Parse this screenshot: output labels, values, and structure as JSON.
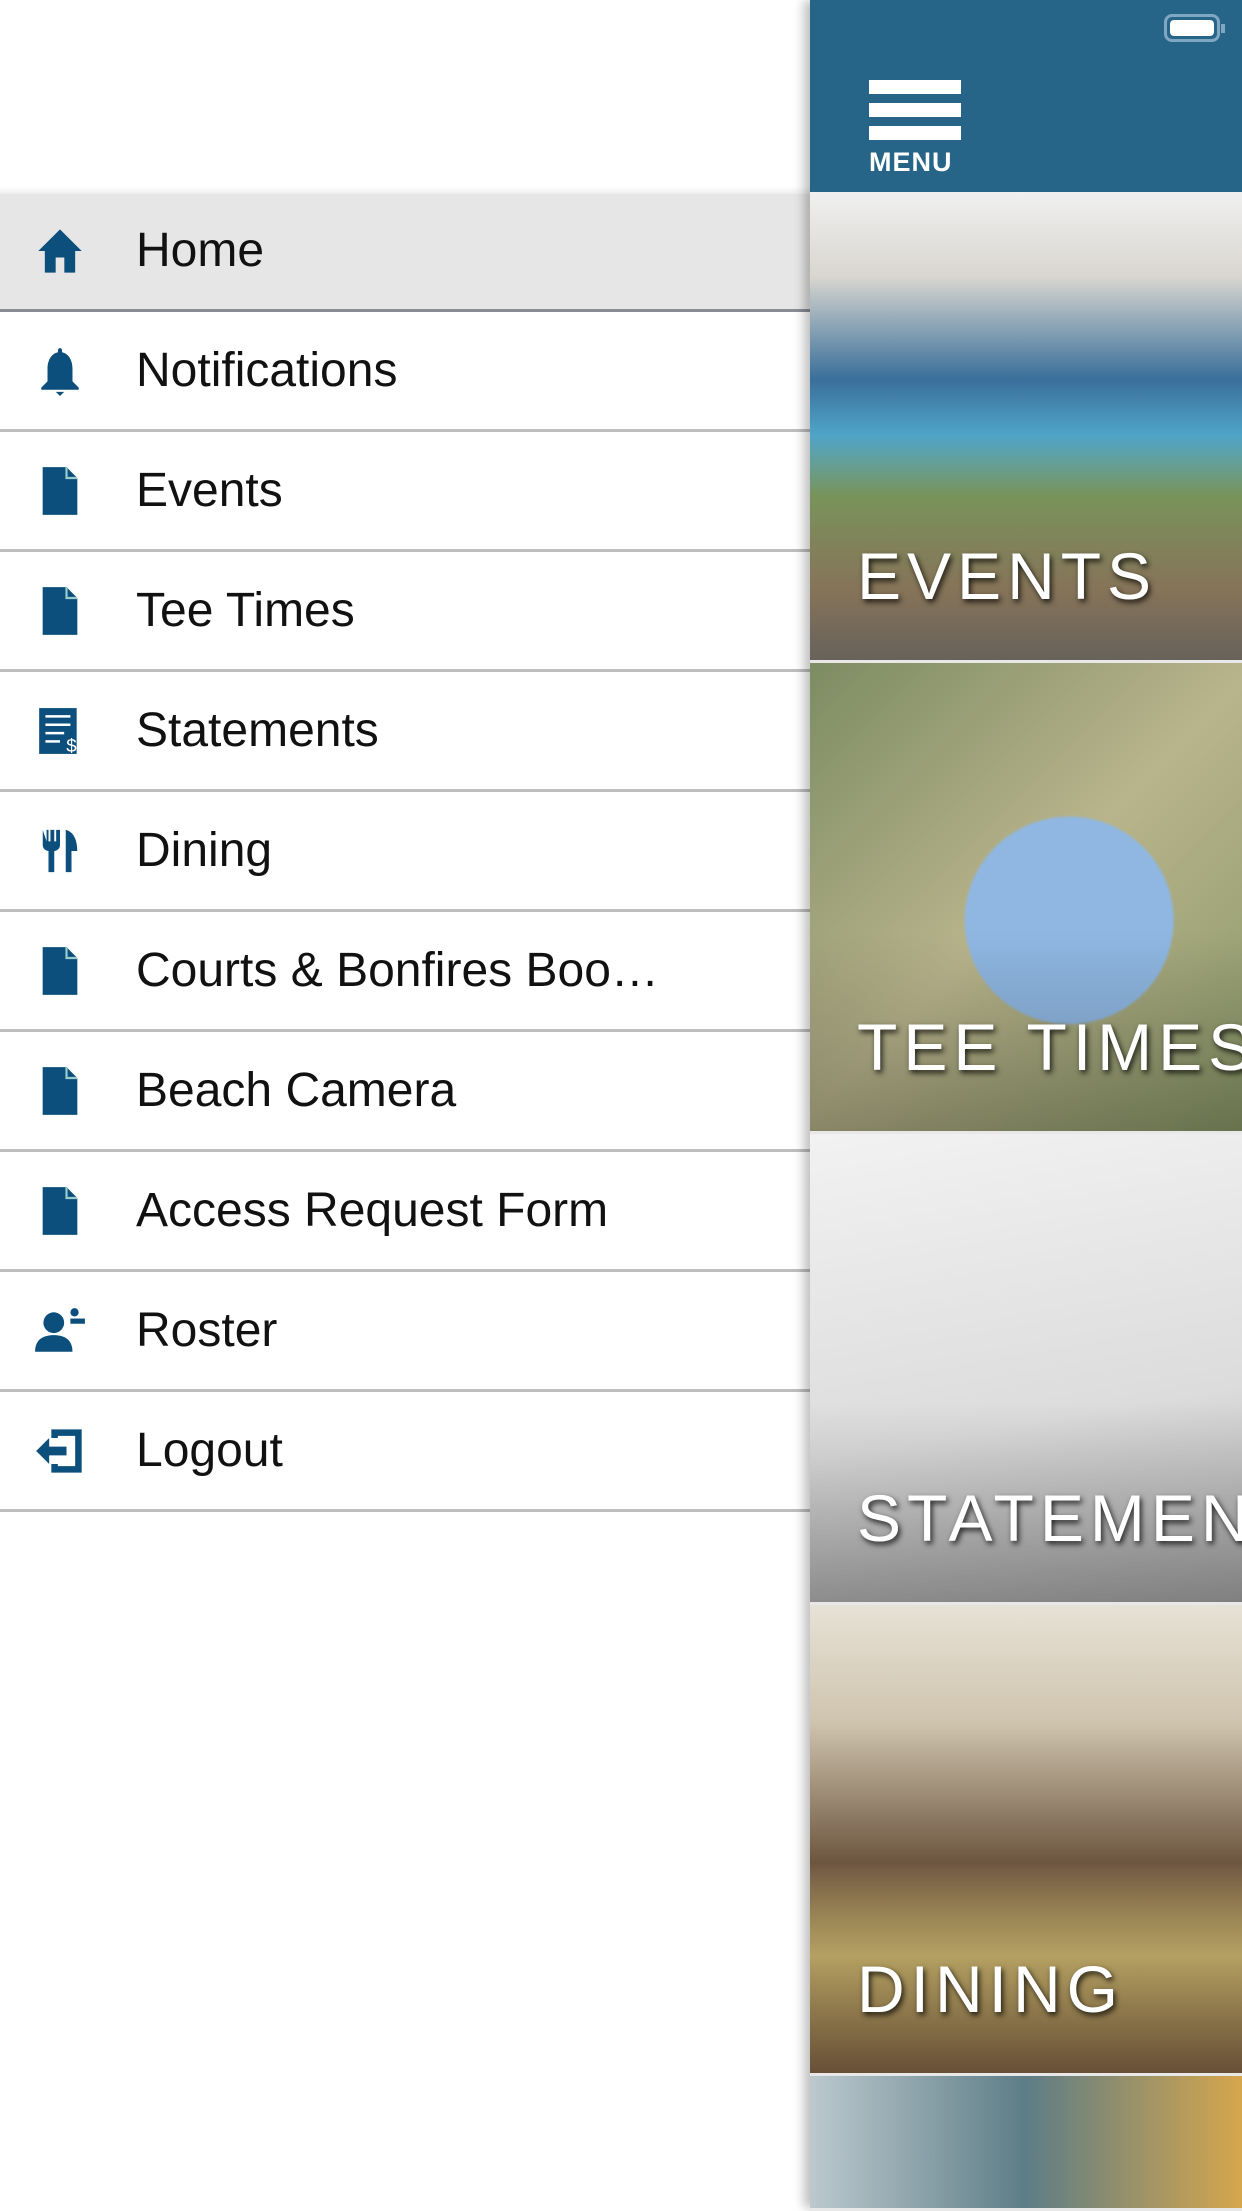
{
  "drawer": {
    "items": [
      {
        "label": "Home",
        "icon": "home-icon",
        "active": true
      },
      {
        "label": "Notifications",
        "icon": "bell-icon"
      },
      {
        "label": "Events",
        "icon": "document-icon"
      },
      {
        "label": "Tee Times",
        "icon": "document-icon"
      },
      {
        "label": "Statements",
        "icon": "statement-icon"
      },
      {
        "label": "Dining",
        "icon": "utensils-icon"
      },
      {
        "label": "Courts & Bonfires Boo…",
        "icon": "document-icon"
      },
      {
        "label": "Beach Camera",
        "icon": "document-icon"
      },
      {
        "label": "Access Request Form",
        "icon": "document-icon"
      },
      {
        "label": "Roster",
        "icon": "person-icon"
      },
      {
        "label": "Logout",
        "icon": "logout-icon"
      }
    ]
  },
  "header": {
    "menu_label": "MENU",
    "color": "#266588"
  },
  "tiles": [
    {
      "label": "EVENTS"
    },
    {
      "label": "TEE TIMES"
    },
    {
      "label": "STATEMEN"
    },
    {
      "label": "DINING"
    }
  ],
  "colors": {
    "icon": "#0d4f7c",
    "active_bg": "#e6e6e6"
  }
}
